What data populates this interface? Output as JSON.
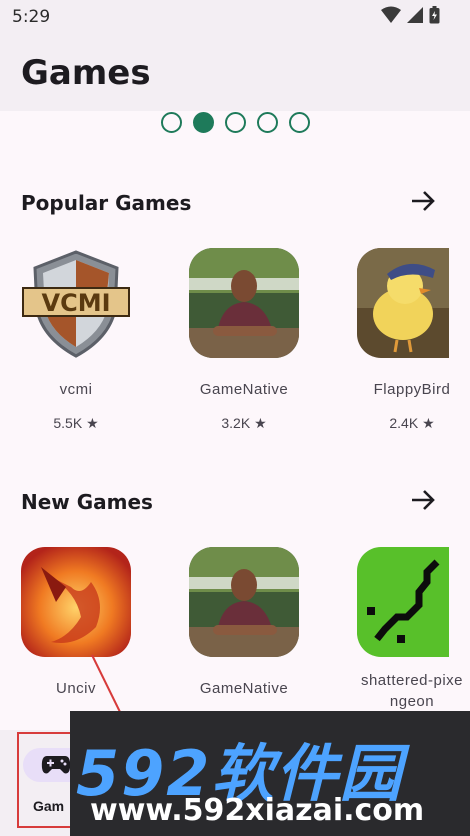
{
  "status_bar": {
    "time": "5:29"
  },
  "app_bar": {
    "title": "Games"
  },
  "carousel": {
    "page_count": 5,
    "active_index": 1
  },
  "sections": [
    {
      "title": "Popular Games",
      "apps": [
        {
          "name": "vcmi",
          "rating": "5.5K ★"
        },
        {
          "name": "GameNative",
          "rating": "3.2K ★"
        },
        {
          "name": "FlappyBird",
          "rating": "2.4K ★"
        }
      ]
    },
    {
      "title": "New Games",
      "apps": [
        {
          "name": "Unciv"
        },
        {
          "name": "GameNative"
        },
        {
          "name": "shattered-pixel-dungeon",
          "name_line1": "shattered-pixe",
          "name_line2": "ngeon"
        }
      ]
    }
  ],
  "bottom_nav": {
    "games_label": "Games",
    "games_label_visible": "Gam"
  },
  "watermark": {
    "brand": "592软件园",
    "url": "www.592xiazai.com"
  },
  "colors": {
    "accent": "#1e7a5a",
    "background": "#fdf7fb",
    "bar": "#f3eef3",
    "nav_pill": "#e8def8",
    "highlight_border": "#d73b3b"
  }
}
